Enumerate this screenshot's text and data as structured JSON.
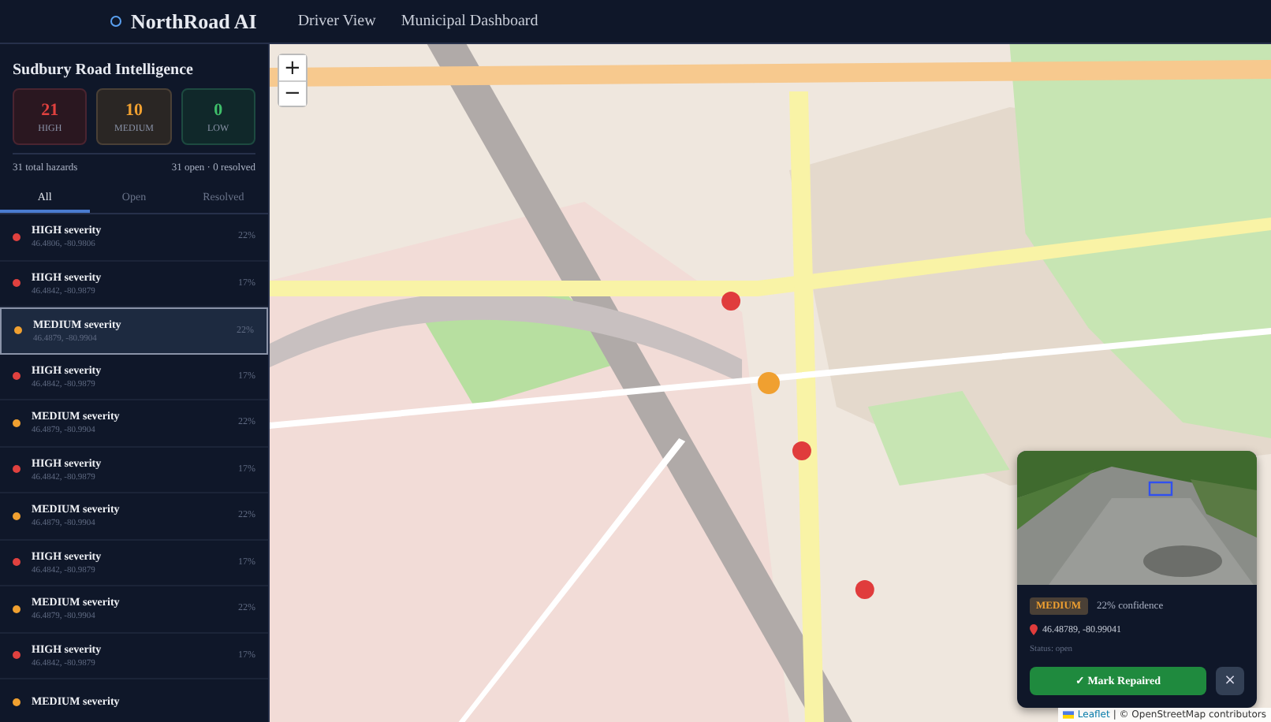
{
  "header": {
    "brand": "NorthRoad AI",
    "nav": [
      {
        "label": "Driver View",
        "selected": false
      },
      {
        "label": "Municipal Dashboard",
        "selected": false
      }
    ]
  },
  "sidebar": {
    "title": "Sudbury Road Intelligence",
    "stats": [
      {
        "kind": "high",
        "value": "21",
        "label": "HIGH"
      },
      {
        "kind": "medium",
        "value": "10",
        "label": "MEDIUM"
      },
      {
        "kind": "low",
        "value": "0",
        "label": "LOW"
      }
    ],
    "summary": {
      "total": "31 total hazards",
      "status": "31 open · 0 resolved"
    },
    "tabs": [
      {
        "label": "All",
        "selected": true
      },
      {
        "label": "Open",
        "selected": false
      },
      {
        "label": "Resolved",
        "selected": false
      }
    ],
    "hazards": [
      {
        "kind": "high",
        "title": "HIGH severity",
        "coords": "46.4806, -80.9806",
        "confidence": "22%",
        "selected": false
      },
      {
        "kind": "high",
        "title": "HIGH severity",
        "coords": "46.4842, -80.9879",
        "confidence": "17%",
        "selected": false
      },
      {
        "kind": "medium",
        "title": "MEDIUM severity",
        "coords": "46.4879, -80.9904",
        "confidence": "22%",
        "selected": true
      },
      {
        "kind": "high",
        "title": "HIGH severity",
        "coords": "46.4842, -80.9879",
        "confidence": "17%",
        "selected": false
      },
      {
        "kind": "medium",
        "title": "MEDIUM severity",
        "coords": "46.4879, -80.9904",
        "confidence": "22%",
        "selected": false
      },
      {
        "kind": "high",
        "title": "HIGH severity",
        "coords": "46.4842, -80.9879",
        "confidence": "17%",
        "selected": false
      },
      {
        "kind": "medium",
        "title": "MEDIUM severity",
        "coords": "46.4879, -80.9904",
        "confidence": "22%",
        "selected": false
      },
      {
        "kind": "high",
        "title": "HIGH severity",
        "coords": "46.4842, -80.9879",
        "confidence": "17%",
        "selected": false
      },
      {
        "kind": "medium",
        "title": "MEDIUM severity",
        "coords": "46.4879, -80.9904",
        "confidence": "22%",
        "selected": false
      },
      {
        "kind": "high",
        "title": "HIGH severity",
        "coords": "46.4842, -80.9879",
        "confidence": "17%",
        "selected": false
      },
      {
        "kind": "medium",
        "title": "MEDIUM severity",
        "selected": false
      }
    ]
  },
  "map": {
    "zoom_in": "+",
    "zoom_out": "−",
    "attribution": {
      "link": "Leaflet",
      "rest": "| © OpenStreetMap contributors"
    },
    "popup": {
      "severity": "MEDIUM",
      "kind": "medium",
      "confidence": "22% confidence",
      "coords": "46.48789, -80.99041",
      "status": "Status: open",
      "action": "✓ Mark Repaired",
      "close": "×"
    }
  }
}
